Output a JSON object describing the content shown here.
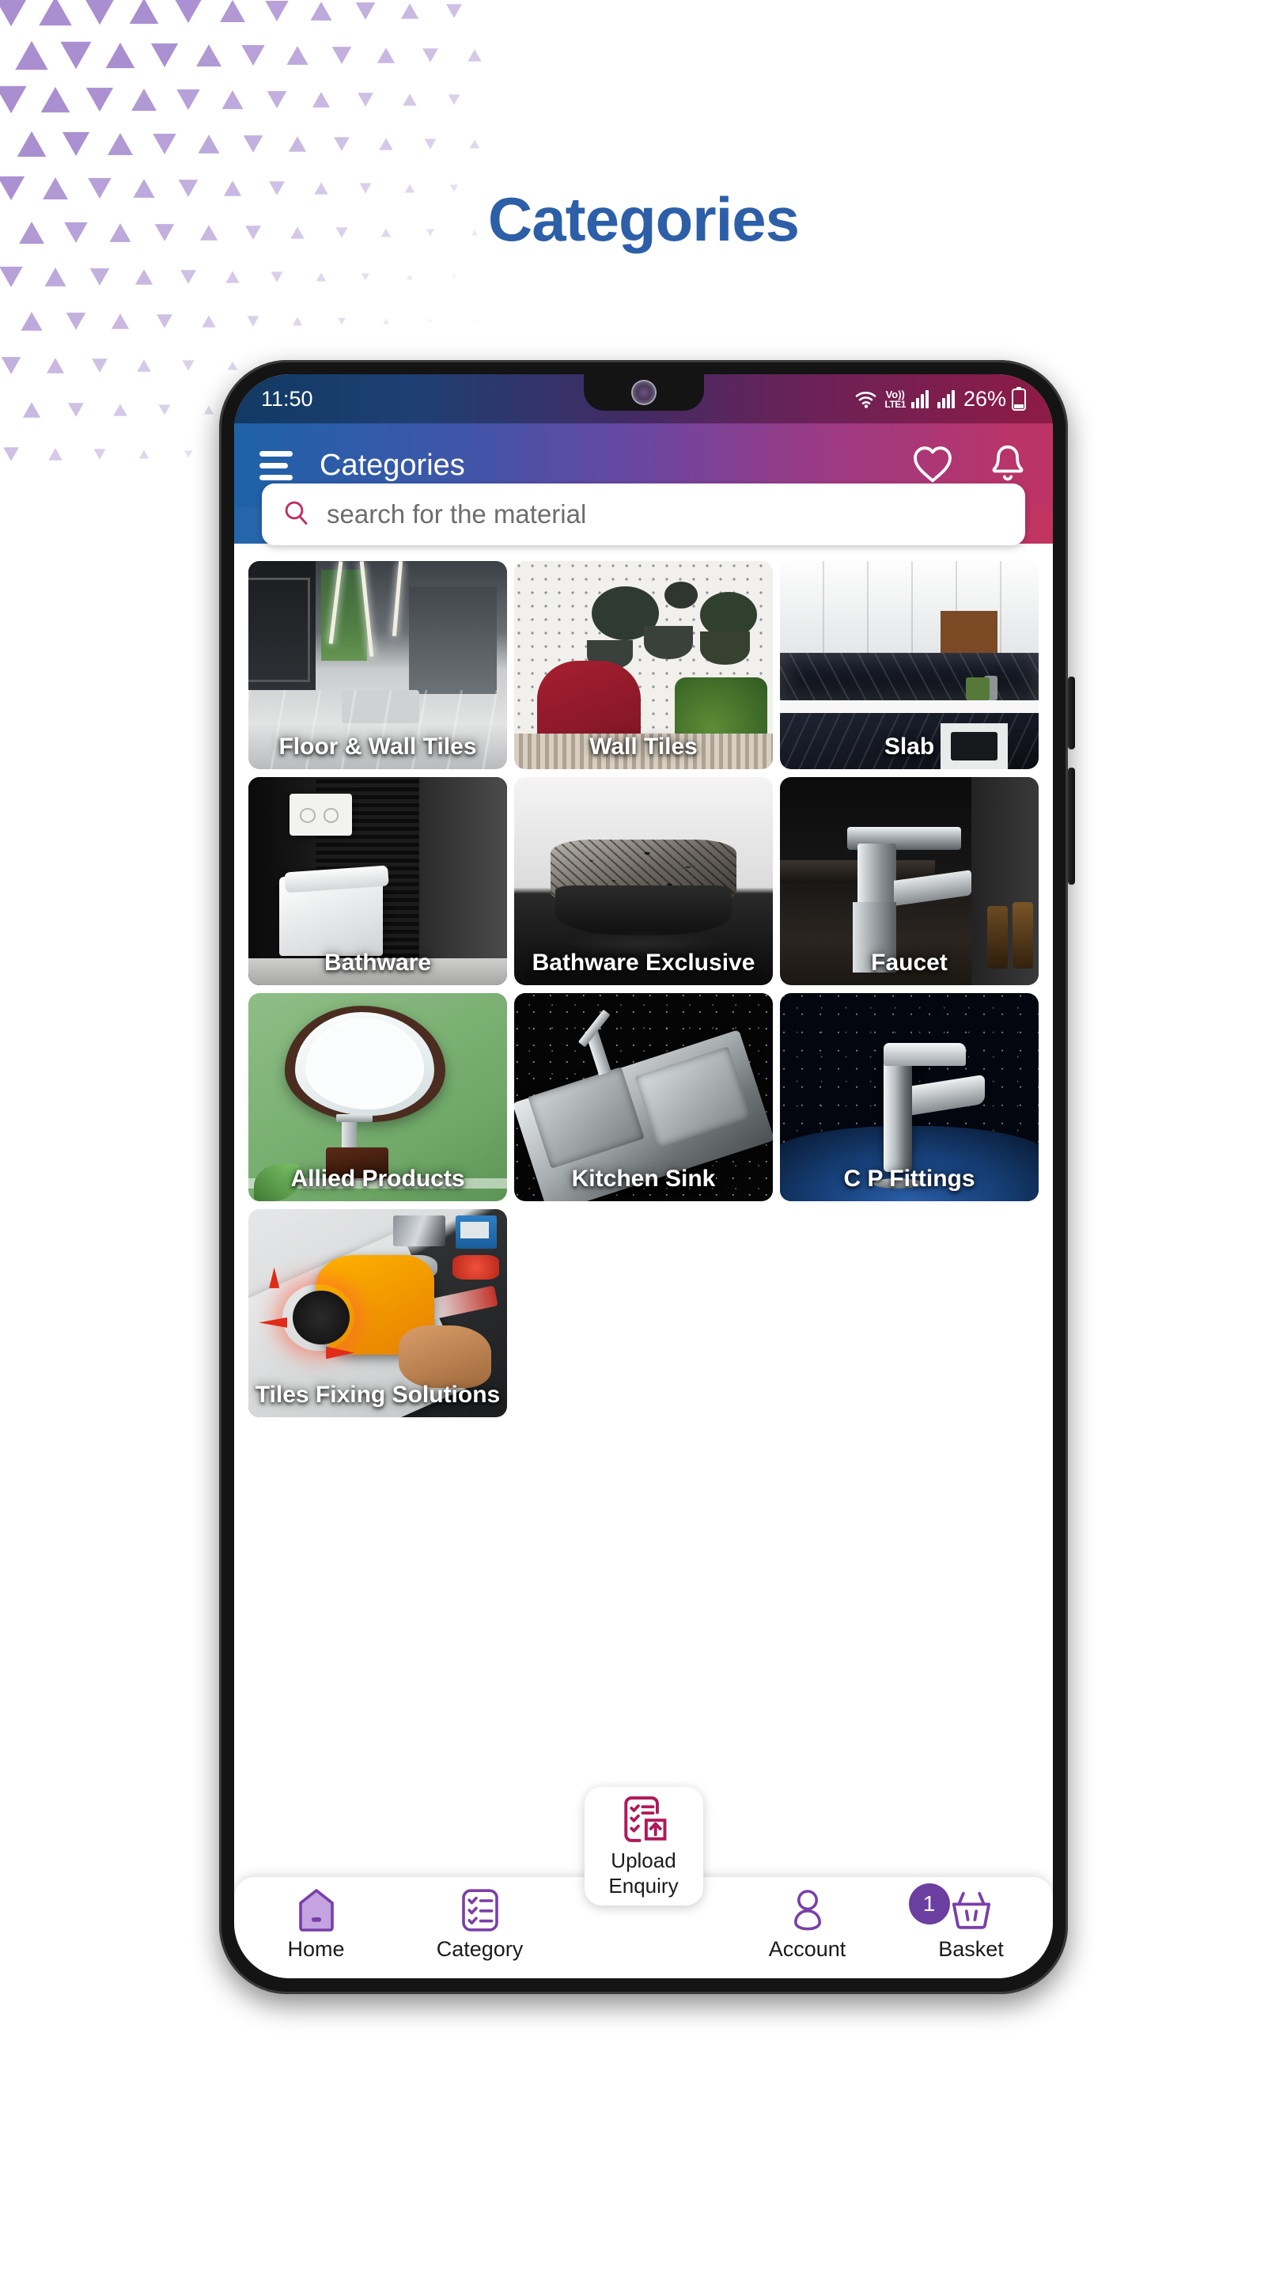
{
  "page": {
    "title": "Categories",
    "title_color": "#2d5fa8",
    "pattern_color": "#a98fd0"
  },
  "phone": {
    "statusbar": {
      "time": "11:50",
      "network_label": "Vo)) LTE1",
      "battery_percent": "26%",
      "icons": [
        "wifi-icon",
        "volte-icon",
        "signal-bars-icon",
        "signal-bars-icon",
        "battery-icon"
      ]
    },
    "appbar": {
      "menu_icon": "hamburger-menu-icon",
      "title": "Categories",
      "favorites_icon": "heart-icon",
      "notifications_icon": "bell-icon",
      "gradient_start": "#1e62a8",
      "gradient_end": "#bf3364"
    },
    "search": {
      "placeholder": "search for the material",
      "value": "",
      "icon": "search-icon",
      "icon_color": "#bf2d5f"
    },
    "categories": [
      {
        "label": "Floor & Wall Tiles",
        "image": "modern-lobby-marble-floor-photo"
      },
      {
        "label": "Wall Tiles",
        "image": "red-armchair-patterned-wall-photo"
      },
      {
        "label": "Slab",
        "image": "white-kitchen-dark-marble-slab-photo"
      },
      {
        "label": "Bathware",
        "image": "wall-hung-toilet-dark-tile-photo"
      },
      {
        "label": "Bathware Exclusive",
        "image": "patterned-vessel-basin-photo"
      },
      {
        "label": "Faucet",
        "image": "chrome-basin-mixer-photo"
      },
      {
        "label": "Allied Products",
        "image": "green-wall-oval-mirror-photo"
      },
      {
        "label": "Kitchen Sink",
        "image": "stainless-double-bowl-sink-photo"
      },
      {
        "label": "C P Fittings",
        "image": "chrome-tall-faucet-blue-photo"
      },
      {
        "label": "Tiles Fixing Solutions",
        "image": "tile-levelling-tool-photo"
      }
    ],
    "bottom_nav": {
      "items": [
        {
          "label": "Home",
          "icon": "home-icon",
          "active": true,
          "badge": ""
        },
        {
          "label": "Category",
          "icon": "checklist-icon",
          "active": false,
          "badge": ""
        },
        {
          "label": "Account",
          "icon": "person-icon",
          "active": false,
          "badge": ""
        },
        {
          "label": "Basket",
          "icon": "basket-icon",
          "active": false,
          "badge": "1"
        }
      ],
      "fab": {
        "label_line1": "Upload",
        "label_line2": "Enquiry",
        "icon": "upload-enquiry-icon",
        "icon_color": "#b0185a"
      },
      "accent_color": "#7a3fa8",
      "badge_color": "#6b3fa0"
    }
  }
}
